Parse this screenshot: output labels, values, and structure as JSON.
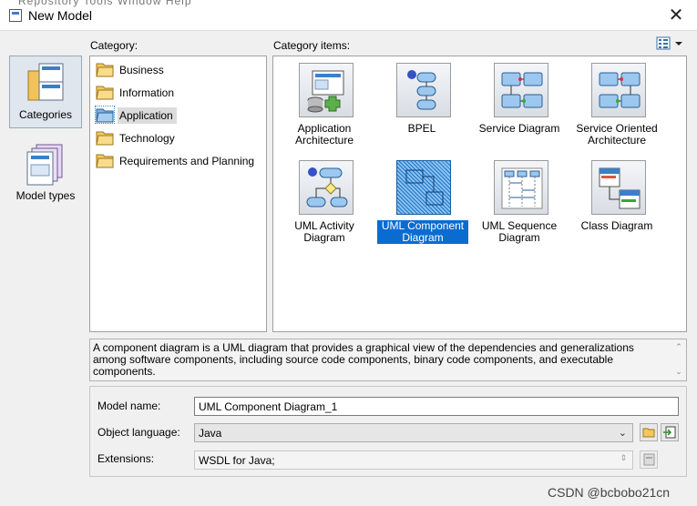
{
  "window": {
    "title": "New Model",
    "menu_ghost": "Repository   Tools   Window   Help"
  },
  "nav": [
    {
      "label": "Categories",
      "selected": true
    },
    {
      "label": "Model types",
      "selected": false
    }
  ],
  "category": {
    "label": "Category:",
    "items": [
      "Business",
      "Information",
      "Application",
      "Technology",
      "Requirements and Planning"
    ],
    "selected": "Application"
  },
  "category_items": {
    "label": "Category items:",
    "tiles": [
      {
        "label": "Application Architecture",
        "icon": "application-architecture-icon"
      },
      {
        "label": "BPEL",
        "icon": "bpel-icon"
      },
      {
        "label": "Service Diagram",
        "icon": "service-diagram-icon"
      },
      {
        "label": "Service Oriented Architecture",
        "icon": "soa-icon"
      },
      {
        "label": "UML Activity Diagram",
        "icon": "activity-diagram-icon"
      },
      {
        "label": "UML Component Diagram",
        "icon": "component-diagram-icon",
        "selected": true
      },
      {
        "label": "UML Sequence Diagram",
        "icon": "sequence-diagram-icon"
      },
      {
        "label": "Class Diagram",
        "icon": "class-diagram-icon"
      }
    ]
  },
  "description": "A component diagram is a UML diagram that provides a graphical view of the dependencies and generalizations among software components, including source code components, binary code components, and executable components.",
  "form": {
    "model_name_label": "Model name:",
    "model_name_value": "UML Component Diagram_1",
    "object_language_label": "Object language:",
    "object_language_value": "Java",
    "extensions_label": "Extensions:",
    "extensions_value": "WSDL for Java;"
  },
  "watermark": "CSDN @bcbobo21cn",
  "colors": {
    "selection": "#0b6cd0",
    "accent": "#3c7fc9"
  }
}
